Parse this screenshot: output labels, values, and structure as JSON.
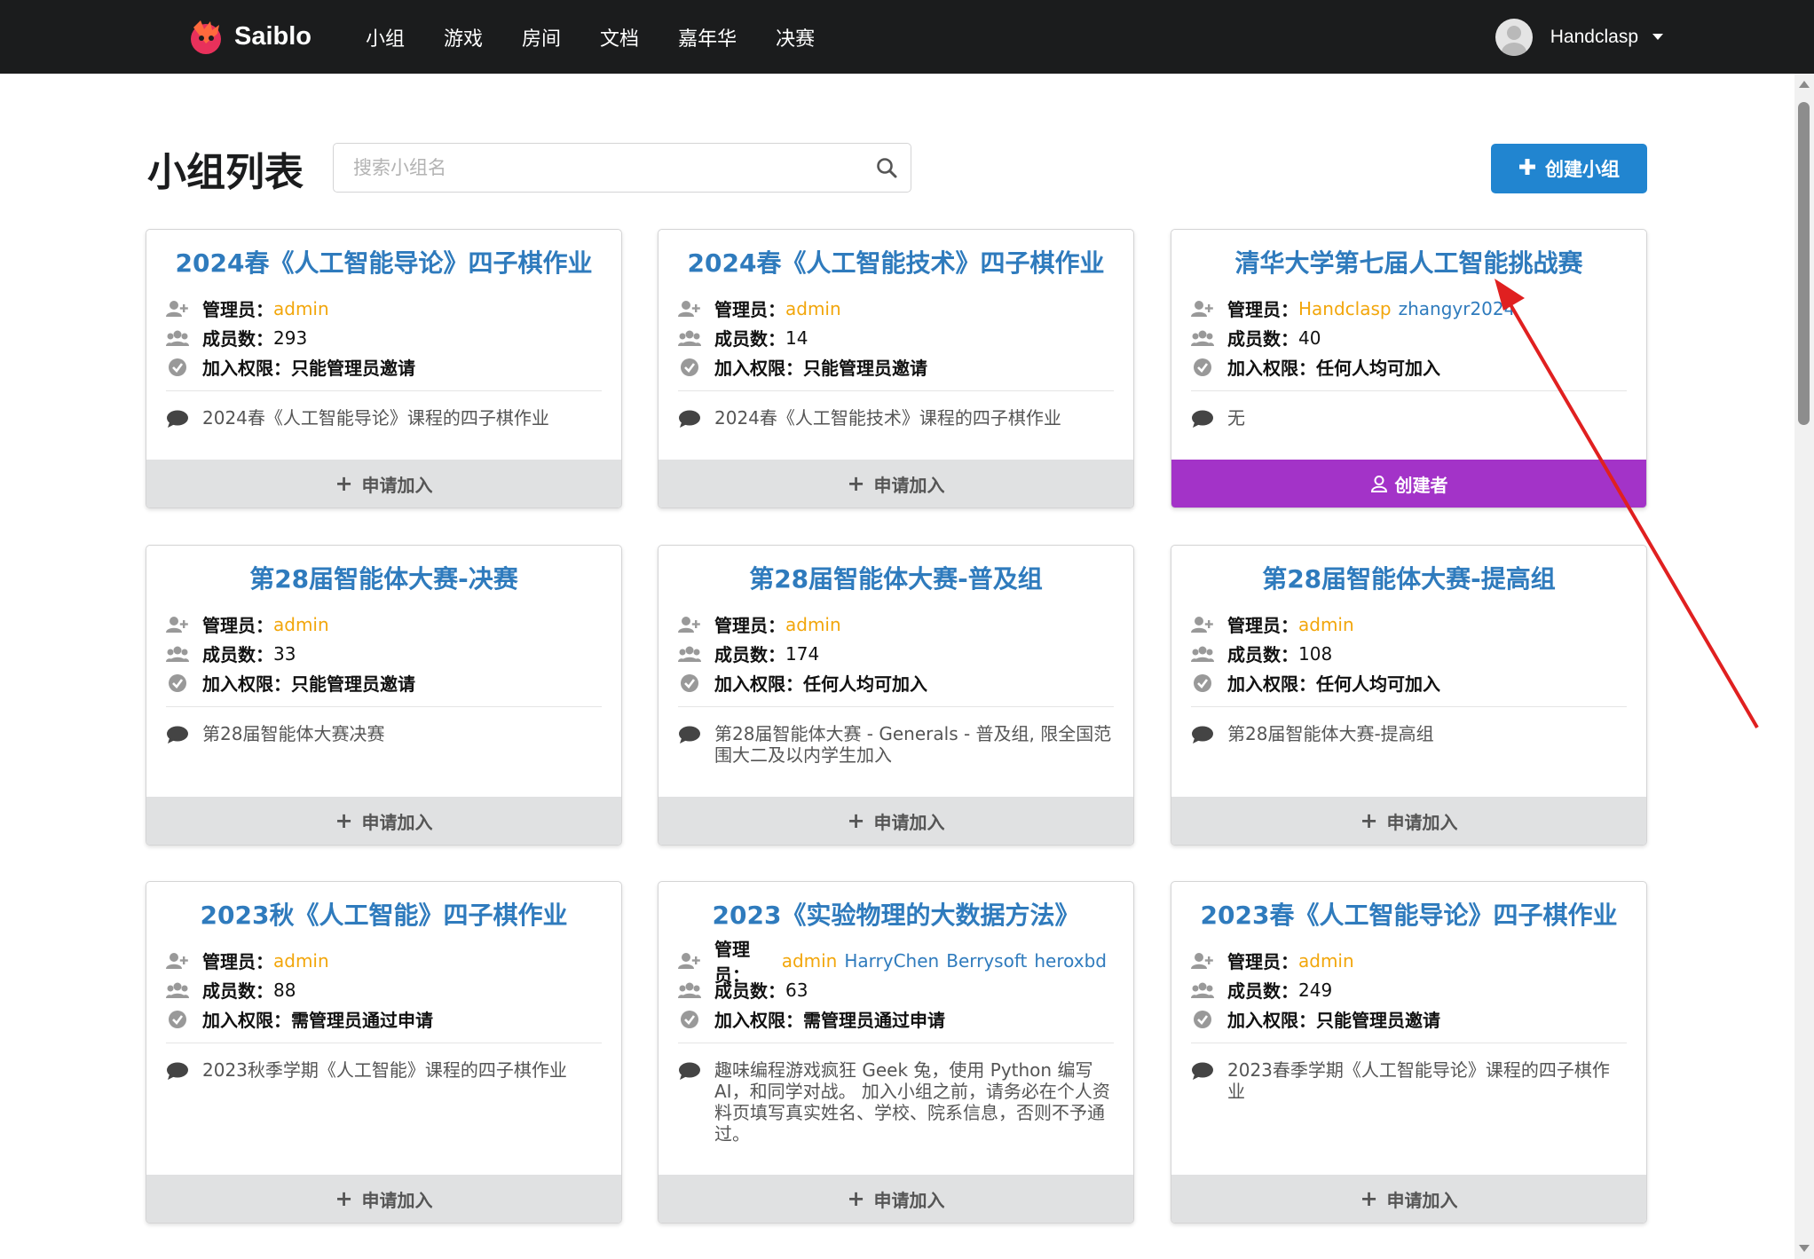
{
  "navbar": {
    "brand": "Saiblo",
    "items": [
      "小组",
      "游戏",
      "房间",
      "文档",
      "嘉年华",
      "决赛"
    ],
    "user": "Handclasp"
  },
  "header": {
    "title": "小组列表",
    "search_placeholder": "搜索小组名",
    "create_label": "创建小组"
  },
  "labels": {
    "admin": "管理员：",
    "members": "成员数：",
    "permission": "加入权限："
  },
  "groups": [
    {
      "title": "2024春《人工智能导论》四子棋作业",
      "admins": [
        "admin"
      ],
      "members": "293",
      "permission": "只能管理员邀请",
      "description": "2024春《人工智能导论》课程的四子棋作业",
      "action": "申请加入"
    },
    {
      "title": "2024春《人工智能技术》四子棋作业",
      "admins": [
        "admin"
      ],
      "members": "14",
      "permission": "只能管理员邀请",
      "description": "2024春《人工智能技术》课程的四子棋作业",
      "action": "申请加入"
    },
    {
      "title": "清华大学第七届人工智能挑战赛",
      "admins": [
        "Handclasp",
        "zhangyr2024"
      ],
      "members": "40",
      "permission": "任何人均可加入",
      "description": "无",
      "action": "创建者"
    },
    {
      "title": "第28届智能体大赛-决赛",
      "admins": [
        "admin"
      ],
      "members": "33",
      "permission": "只能管理员邀请",
      "description": "第28届智能体大赛决赛",
      "action": "申请加入"
    },
    {
      "title": "第28届智能体大赛-普及组",
      "admins": [
        "admin"
      ],
      "members": "174",
      "permission": "任何人均可加入",
      "description": "第28届智能体大赛 - Generals - 普及组, 限全国范围大二及以内学生加入",
      "action": "申请加入"
    },
    {
      "title": "第28届智能体大赛-提高组",
      "admins": [
        "admin"
      ],
      "members": "108",
      "permission": "任何人均可加入",
      "description": "第28届智能体大赛-提高组",
      "action": "申请加入"
    },
    {
      "title": "2023秋《人工智能》四子棋作业",
      "admins": [
        "admin"
      ],
      "members": "88",
      "permission": "需管理员通过申请",
      "description": "2023秋季学期《人工智能》课程的四子棋作业",
      "action": "申请加入"
    },
    {
      "title": "2023《实验物理的大数据方法》",
      "admins": [
        "admin",
        "HarryChen",
        "Berrysoft",
        "heroxbd"
      ],
      "members": "63",
      "permission": "需管理员通过申请",
      "description": "趣味编程游戏疯狂 Geek 兔，使用 Python 编写 AI，和同学对战。 加入小组之前，请务必在个人资料页填写真实姓名、学校、院系信息，否则不予通过。",
      "action": "申请加入"
    },
    {
      "title": "2023春《人工智能导论》四子棋作业",
      "admins": [
        "admin"
      ],
      "members": "249",
      "permission": "只能管理员邀请",
      "description": "2023春季学期《人工智能导论》课程的四子棋作业",
      "action": "申请加入"
    }
  ],
  "colors": {
    "navbar": "#1b1c1d",
    "title_blue": "#2f7bbd",
    "admin_orange": "#f2a60b",
    "primary_button": "#2185d0",
    "creator_button": "#a333c8",
    "annotation_arrow": "#e02020"
  }
}
